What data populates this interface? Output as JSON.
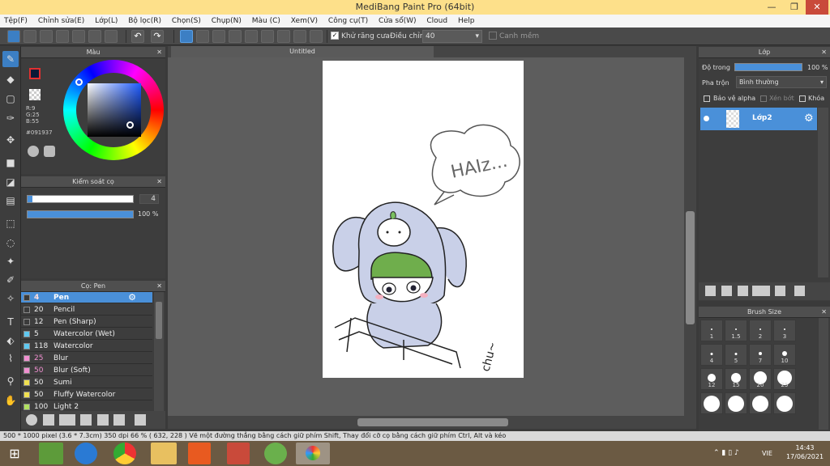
{
  "window": {
    "title": "MediBang Paint Pro (64bit)"
  },
  "menu": [
    "Tệp(F)",
    "Chỉnh sửa(E)",
    "Lớp(L)",
    "Bộ lọc(R)",
    "Chọn(S)",
    "Chụp(N)",
    "Màu (C)",
    "Xem(V)",
    "Công cụ(T)",
    "Cửa sổ(W)",
    "Cloud",
    "Help"
  ],
  "toolbar": {
    "antialias_label": "Khử răng cưa",
    "correction_label": "Điều chỉnh",
    "correction_value": "40",
    "snap_label": "Canh mềm"
  },
  "color_panel": {
    "title": "Màu",
    "rgb": [
      "R:9",
      "G:25",
      "B:55"
    ],
    "hex": "#091937"
  },
  "brush_control": {
    "title": "Kiểm soát cọ",
    "size": "4",
    "opacity": "100 %"
  },
  "brush_panel": {
    "title": "Cọ: Pen",
    "items": [
      {
        "size": "4",
        "name": "Pen",
        "color": "#4a90d9"
      },
      {
        "size": "20",
        "name": "Pencil",
        "color": "#3b3b3b"
      },
      {
        "size": "12",
        "name": "Pen (Sharp)",
        "color": "#3b3b3b"
      },
      {
        "size": "5",
        "name": "Watercolor (Wet)",
        "color": "#5fc8f0"
      },
      {
        "size": "118",
        "name": "Watercolor",
        "color": "#5fc8f0"
      },
      {
        "size": "25",
        "name": "Blur",
        "color": "#f08fd0"
      },
      {
        "size": "50",
        "name": "Blur (Soft)",
        "color": "#f08fd0"
      },
      {
        "size": "50",
        "name": "Sumi",
        "color": "#f0e050"
      },
      {
        "size": "50",
        "name": "Fluffy Watercolor",
        "color": "#f0e050"
      },
      {
        "size": "100",
        "name": "Light 2",
        "color": "#b0e060"
      }
    ]
  },
  "canvas": {
    "tab_title": "Untitled"
  },
  "layer_panel": {
    "title": "Lớp",
    "opacity_label": "Độ trong",
    "opacity_value": "100 %",
    "blend_label": "Pha trộn",
    "blend_value": "Bình thường",
    "protect_alpha": "Bảo vệ alpha",
    "clipping": "Xén bớt",
    "lock": "Khóa",
    "layer_name": "Lớp2"
  },
  "brush_size_panel": {
    "title": "Brush Size",
    "sizes": [
      "1",
      "1.5",
      "2",
      "3",
      "4",
      "5",
      "7",
      "10",
      "12",
      "15",
      "20",
      "25",
      "",
      "",
      "",
      ""
    ]
  },
  "status": {
    "text": "500 * 1000 pixel   (3.6 * 7.3cm)   350 dpi   66 %   ( 632, 228 )   Vẽ một đường thẳng bằng cách giữ phím Shift, Thay đổi cỡ cọ bằng cách giữ phím Ctrl, Alt và kéo"
  },
  "taskbar": {
    "lang": "VIE",
    "time": "14:43",
    "date": "17/06/2021"
  },
  "colors": {
    "accent": "#4a90d9",
    "fg_color": "#091937"
  }
}
